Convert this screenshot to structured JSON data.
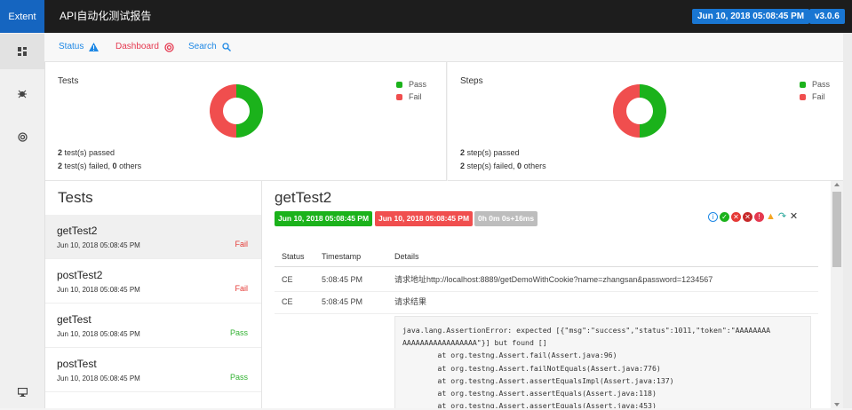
{
  "app": {
    "brand": "Extent",
    "report_name": "API自动化测试报告",
    "date_badge": "Jun 10, 2018 05:08:45 PM",
    "version_badge": "v3.0.6"
  },
  "nav": {
    "status": "Status",
    "dashboard": "Dashboard",
    "search": "Search"
  },
  "dashboard": {
    "tests": {
      "title": "Tests",
      "legend": [
        "Pass",
        "Fail"
      ],
      "passed_count": "2",
      "passed_text": " test(s) passed",
      "failed_count": "2",
      "failed_text": " test(s) failed, ",
      "others_count": "0",
      "others_text": " others",
      "pass_fraction": 0.5
    },
    "steps": {
      "title": "Steps",
      "legend": [
        "Pass",
        "Fail"
      ],
      "passed_count": "2",
      "passed_text": " step(s) passed",
      "failed_count": "2",
      "failed_text": " step(s) failed, ",
      "others_count": "0",
      "others_text": " others",
      "pass_fraction": 0.5
    }
  },
  "colors": {
    "pass": "#1bb21b",
    "fail": "#f04e4e",
    "accent": "#1976d2",
    "skip": "#bdbdbd"
  },
  "tests_panel": {
    "heading": "Tests",
    "items": [
      {
        "name": "getTest2",
        "time": "Jun 10, 2018 05:08:45 PM",
        "status": "Fail"
      },
      {
        "name": "postTest2",
        "time": "Jun 10, 2018 05:08:45 PM",
        "status": "Fail"
      },
      {
        "name": "getTest",
        "time": "Jun 10, 2018 05:08:45 PM",
        "status": "Pass"
      },
      {
        "name": "postTest",
        "time": "Jun 10, 2018 05:08:45 PM",
        "status": "Pass"
      }
    ]
  },
  "detail": {
    "title": "getTest2",
    "start_label": "Jun 10, 2018 05:08:45 PM",
    "end_label": "Jun 10, 2018 05:08:45 PM",
    "duration_label": "0h 0m 0s+16ms",
    "columns": [
      "Status",
      "Timestamp",
      "Details"
    ],
    "rows": [
      {
        "status": "CE",
        "timestamp": "5:08:45 PM",
        "details": "请求地址http://localhost:8889/getDemoWithCookie?name=zhangsan&password=1234567"
      },
      {
        "status": "CE",
        "timestamp": "5:08:45 PM",
        "details": "请求结果"
      }
    ],
    "code": "java.lang.AssertionError: expected [{\"msg\":\"success\",\"status\":1011,\"token\":\"AAAAAAAA\nAAAAAAAAAAAAAAAAA\"}] but found []\n        at org.testng.Assert.fail(Assert.java:96)\n        at org.testng.Assert.failNotEquals(Assert.java:776)\n        at org.testng.Assert.assertEqualsImpl(Assert.java:137)\n        at org.testng.Assert.assertEquals(Assert.java:118)\n        at org.testng.Assert.assertEquals(Assert.java:453)"
  }
}
